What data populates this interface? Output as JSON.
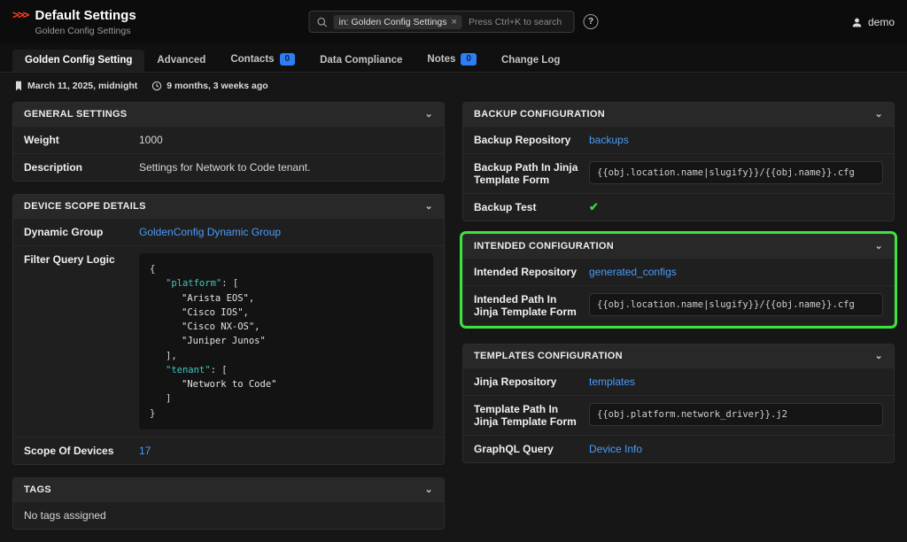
{
  "colors": {
    "accent": "#ff3e1d",
    "link": "#4b9bfa",
    "highlight": "#3ee23e",
    "success": "#35d435",
    "badge": "#2e7df6",
    "key": "#41c8bd"
  },
  "icons": {
    "chevron": "⌄",
    "check": "✔",
    "close": "×",
    "help": "?"
  },
  "header": {
    "logo": ">>>",
    "title": "Default Settings",
    "subtitle": "Golden Config Settings",
    "search": {
      "chip": "in: Golden Config Settings",
      "placeholder": "Press Ctrl+K to search"
    },
    "user": "demo"
  },
  "tabs": {
    "golden": "Golden Config Setting",
    "advanced": "Advanced",
    "contacts": "Contacts",
    "contacts_badge": "0",
    "compliance": "Data Compliance",
    "notes": "Notes",
    "notes_badge": "0",
    "changelog": "Change Log"
  },
  "meta": {
    "created": "March 11, 2025, midnight",
    "age": "9 months, 3 weeks ago"
  },
  "general": {
    "title": "GENERAL SETTINGS",
    "weight_label": "Weight",
    "weight": "1000",
    "description_label": "Description",
    "description": "Settings for Network to Code tenant."
  },
  "scope": {
    "title": "DEVICE SCOPE DETAILS",
    "dynamic_group_label": "Dynamic Group",
    "dynamic_group": "GoldenConfig Dynamic Group",
    "filter_label": "Filter Query Logic",
    "devices_label": "Scope Of Devices",
    "devices": "17",
    "code": [
      {
        "punct": "{"
      },
      {
        "key": "\"platform\"",
        "punct": ": ["
      },
      {
        "str": "\"Arista EOS\","
      },
      {
        "str": "\"Cisco IOS\","
      },
      {
        "str": "\"Cisco NX-OS\","
      },
      {
        "str": "\"Juniper Junos\""
      },
      {
        "punct": "],"
      },
      {
        "key": "\"tenant\"",
        "punct": ": ["
      },
      {
        "str": "\"Network to Code\""
      },
      {
        "punct": "]"
      },
      {
        "punct": "}"
      }
    ]
  },
  "tags": {
    "title": "TAGS",
    "empty": "No tags assigned"
  },
  "backup": {
    "title": "BACKUP CONFIGURATION",
    "repo_label": "Backup Repository",
    "repo": "backups",
    "path_label": "Backup Path In Jinja Template Form",
    "path": "{{obj.location.name|slugify}}/{{obj.name}}.cfg",
    "test_label": "Backup Test"
  },
  "intended": {
    "title": "INTENDED CONFIGURATION",
    "repo_label": "Intended Repository",
    "repo": "generated_configs",
    "path_label": "Intended Path In Jinja Template Form",
    "path": "{{obj.location.name|slugify}}/{{obj.name}}.cfg"
  },
  "templates": {
    "title": "TEMPLATES CONFIGURATION",
    "repo_label": "Jinja Repository",
    "repo": "templates",
    "path_label": "Template Path In Jinja Template Form",
    "path": "{{obj.platform.network_driver}}.j2",
    "graphql_label": "GraphQL Query",
    "graphql": "Device Info"
  }
}
